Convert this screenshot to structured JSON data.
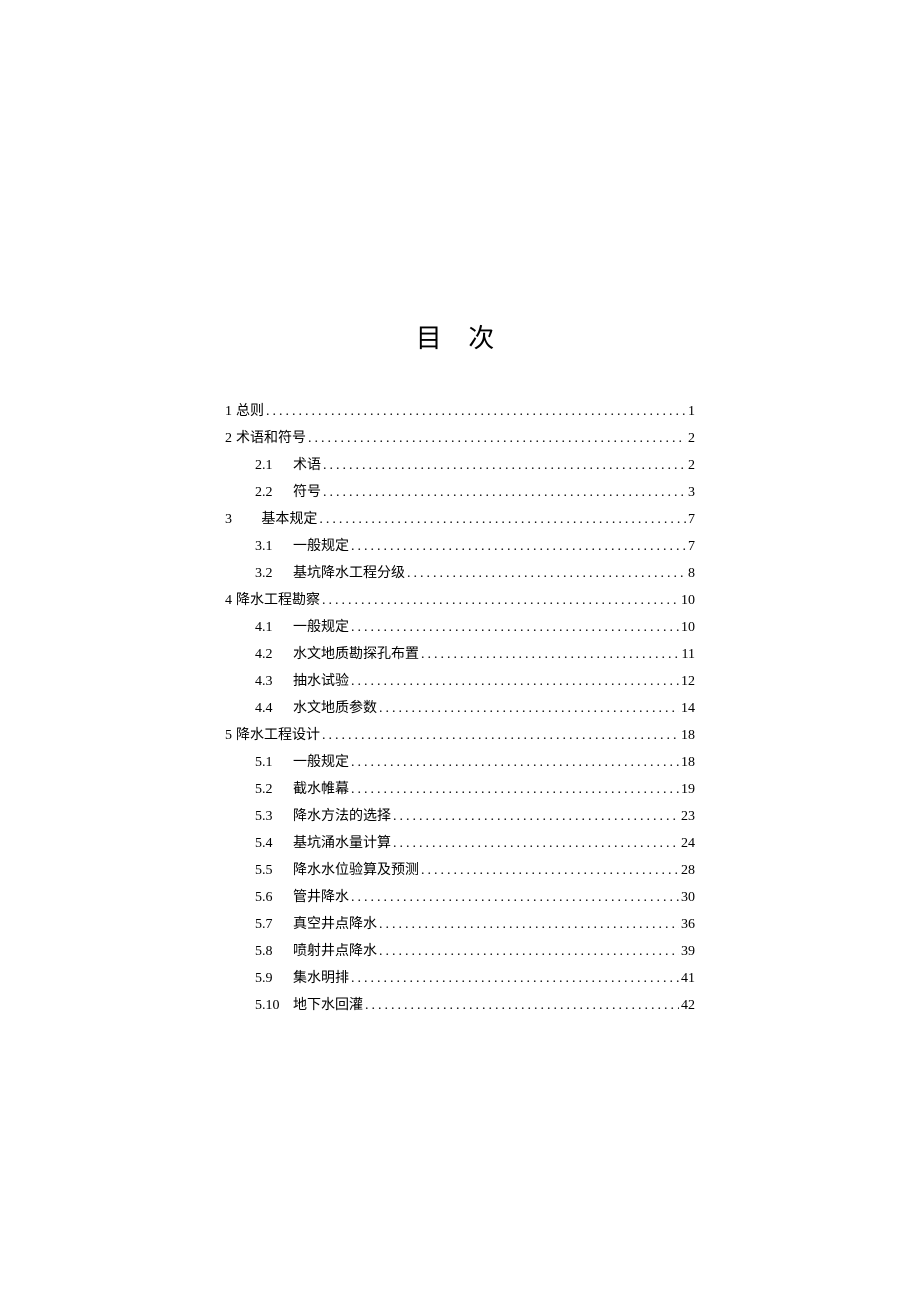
{
  "title": "目 次",
  "toc": [
    {
      "type": "top",
      "num": "1",
      "label": "总则",
      "page": "1"
    },
    {
      "type": "top",
      "num": "2",
      "label": "术语和符号",
      "page": "2"
    },
    {
      "type": "sub",
      "num": "2.1",
      "label": "术语",
      "page": "2"
    },
    {
      "type": "sub",
      "num": "2.2",
      "label": "符号",
      "page": "3"
    },
    {
      "type": "ch3",
      "num": "3",
      "label": "基本规定",
      "page": "7"
    },
    {
      "type": "sub",
      "num": "3.1",
      "label": "一般规定",
      "page": "7"
    },
    {
      "type": "sub",
      "num": "3.2",
      "label": "基坑降水工程分级",
      "page": "8"
    },
    {
      "type": "top",
      "num": "4",
      "label": "降水工程勘察",
      "page": "10"
    },
    {
      "type": "sub",
      "num": "4.1",
      "label": "一般规定",
      "page": "10"
    },
    {
      "type": "sub",
      "num": "4.2",
      "label": "水文地质勘探孔布置",
      "page": "11"
    },
    {
      "type": "sub",
      "num": "4.3",
      "label": "抽水试验",
      "page": "12"
    },
    {
      "type": "sub",
      "num": "4.4",
      "label": "水文地质参数",
      "page": "14"
    },
    {
      "type": "top",
      "num": "5",
      "label": "降水工程设计",
      "page": "18"
    },
    {
      "type": "sub",
      "num": "5.1",
      "label": "一般规定",
      "page": "18"
    },
    {
      "type": "sub",
      "num": "5.2",
      "label": "截水帷幕",
      "page": "19"
    },
    {
      "type": "sub",
      "num": "5.3",
      "label": "降水方法的选择",
      "page": "23"
    },
    {
      "type": "sub",
      "num": "5.4",
      "label": "基坑涌水量计算",
      "page": "24"
    },
    {
      "type": "sub",
      "num": "5.5",
      "label": "降水水位验算及预测",
      "page": "28"
    },
    {
      "type": "sub",
      "num": "5.6",
      "label": "管井降水",
      "page": "30"
    },
    {
      "type": "sub",
      "num": "5.7",
      "label": "真空井点降水",
      "page": "36"
    },
    {
      "type": "sub",
      "num": "5.8",
      "label": "喷射井点降水",
      "page": "39"
    },
    {
      "type": "sub",
      "num": "5.9",
      "label": "集水明排",
      "page": "41"
    },
    {
      "type": "sub",
      "num": "5.10",
      "label": "地下水回灌",
      "page": "42"
    }
  ]
}
